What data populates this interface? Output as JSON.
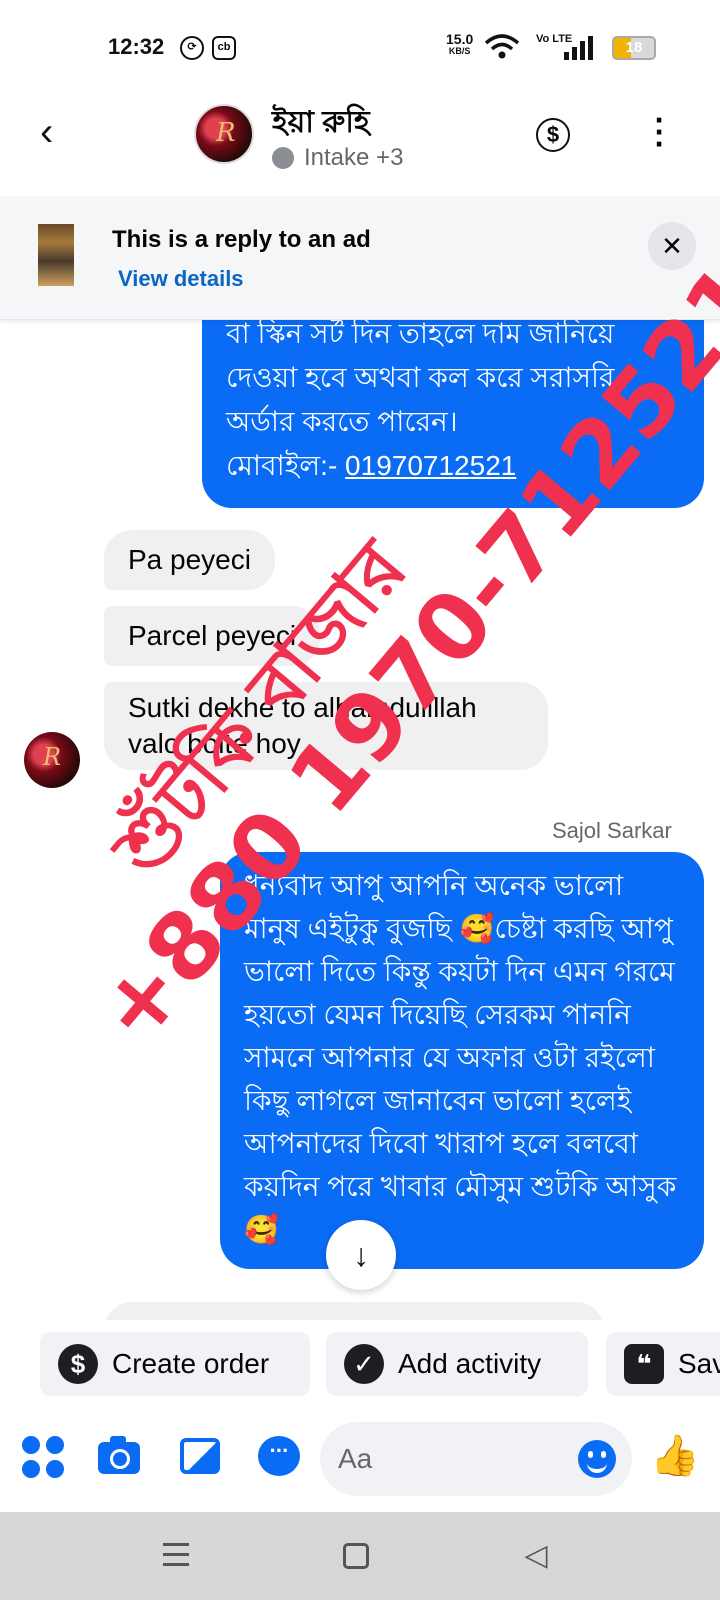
{
  "status_bar": {
    "time": "12:32",
    "speed_value": "15.0",
    "speed_unit": "KB/S",
    "network": "Vo LTE",
    "battery": "18"
  },
  "header": {
    "contact_name": "ইয়া রুহি",
    "presence_text": "Intake +3"
  },
  "ad_banner": {
    "title": "This is a reply to an ad",
    "link": "View details"
  },
  "messages": {
    "out1_lines": [
      "বা স্কিন সর্ট দিন তাহলে দাম জানিয়ে",
      "দেওয়া হবে অথবা কল করে সরাসরি",
      "অর্ডার করতে পারেন।"
    ],
    "out1_phone_label": "মোবাইল:- ",
    "out1_phone": "01970712521",
    "in1": "Pa peyeci",
    "in2": "Parcel peyeci",
    "in3": "Sutki dekhe to alhamdulillah valo bolte hoy",
    "sender_label": "Sajol Sarkar",
    "out2": "ধন্যবাদ আপু আপনি অনেক ভালো মানুষ এইটুকু বুজছি 🥰চেষ্টা করছি আপু ভালো দিতে কিন্তু কয়টা দিন এমন গরমে হয়তো যেমন দিয়েছি সেরকম পাননি সামনে আপনার যে অফার ওটা রইলো কিছু লাগলে জানাবেন ভালো হলেই আপনাদের দিবো খারাপ হলে বলবো কয়দিন পরে খাবার মৌসুম শুটকি আসুক🥰"
  },
  "watermark": {
    "brand": "শুঁটকি বাজার",
    "phone": "+880 1970-712521",
    "color": "#f0304f"
  },
  "chips": {
    "create_order": "Create order",
    "add_activity": "Add activity",
    "saved": "Saved"
  },
  "composer": {
    "placeholder": "Aa"
  },
  "colors": {
    "accent": "#0a6cf5",
    "incoming_bubble": "#f0f0f0"
  }
}
